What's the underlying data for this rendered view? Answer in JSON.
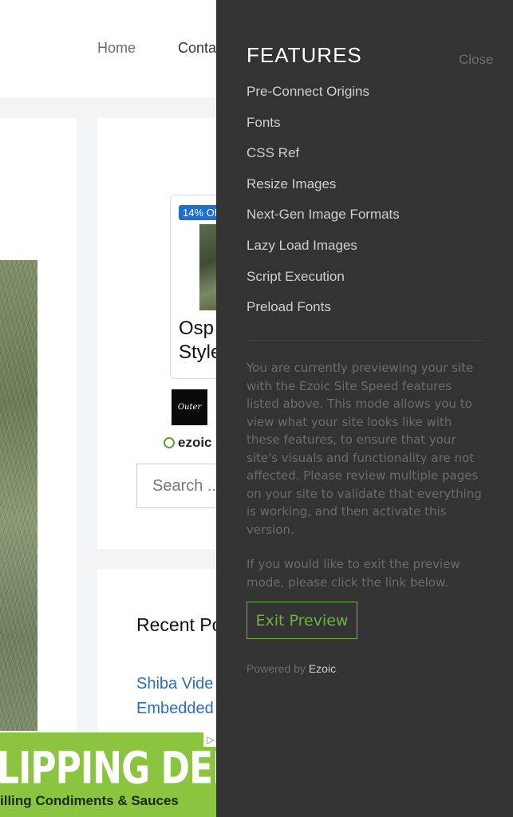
{
  "site": {
    "nav": {
      "home": "Home",
      "contact": "Conta"
    },
    "ad": {
      "badge": "14% Of",
      "title_line1": "Osp",
      "title_line2": "Style"
    },
    "brand_logo_text": "Outer",
    "ezoic_label": "ezoic",
    "search_placeholder": "Search ...",
    "recent": {
      "title": "Recent Po",
      "link_line1": "Shiba Vide",
      "link_line2": "Embedded"
    },
    "bottom_ad": {
      "headline": "LIPPING DELICIOUS",
      "sub": "illing Condiments & Sauces",
      "choice": "▷"
    }
  },
  "drawer": {
    "title": "FEATURES",
    "close": "Close",
    "features": [
      "Pre-Connect Origins",
      "Fonts",
      "CSS Ref",
      "Resize Images",
      "Next-Gen Image Formats",
      "Lazy Load Images",
      "Script Execution",
      "Preload Fonts"
    ],
    "description": "You are currently previewing your site with the Ezoic Site Speed features listed above. This mode allows you to view what your site looks like with these features, to ensure that your site's visuals and functionality are not affected. Please review multiple pages on your site to validate that everything is working, and then activate this version.",
    "exit_note": "If you would like to exit the preview mode, please click the link below.",
    "exit_button": "Exit Preview",
    "powered_by": "Powered by",
    "powered_brand": "Ezoic",
    "powered_suffix": "."
  },
  "colors": {
    "drawer_bg": "#333333",
    "accent_green": "#6db33f",
    "link_blue": "#2a6ebd",
    "ad_green": "#8bc53f"
  }
}
